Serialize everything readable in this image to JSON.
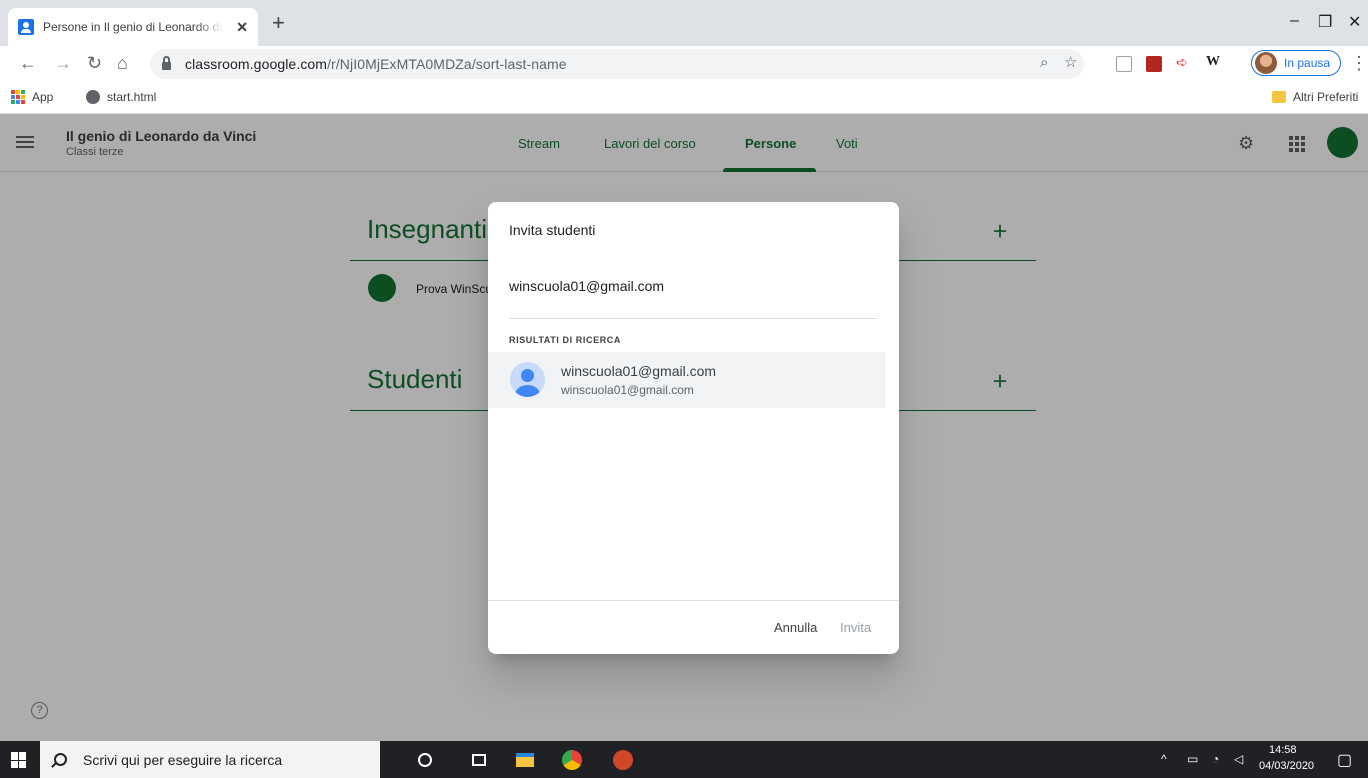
{
  "browser": {
    "tab_title": "Persone in Il genio di Leonardo da Vinci",
    "tab_close": "✕",
    "new_tab": "+",
    "url_host": "classroom.google.com",
    "url_path": "/r/NjI0MjExMTA0MDZa/sort-last-name",
    "profile_label": "In pausa",
    "bookmarks": [
      {
        "label": "App"
      },
      {
        "label": "start.html"
      }
    ],
    "other_bookmarks": "Altri Preferiti"
  },
  "app": {
    "course_title": "Il genio di Leonardo da Vinci",
    "course_subtitle": "Classi terze",
    "tabs": [
      {
        "label": "Stream"
      },
      {
        "label": "Lavori del corso"
      },
      {
        "label": "Persone"
      },
      {
        "label": "Voti"
      }
    ],
    "sections": {
      "teachers_title": "Insegnanti",
      "teacher_name": "Prova WinScuola",
      "students_title": "Studenti"
    }
  },
  "dialog": {
    "title": "Invita studenti",
    "input_value": "winscuola01@gmail.com",
    "results_label": "RISULTATI DI RICERCA",
    "result": {
      "name": "winscuola01@gmail.com",
      "email": "winscuola01@gmail.com"
    },
    "cancel_label": "Annulla",
    "invite_label": "Invita"
  },
  "taskbar": {
    "search_placeholder": "Scrivi qui per eseguire la ricerca",
    "time": "14:58",
    "date": "04/03/2020"
  },
  "colors": {
    "accent": "#137333",
    "scrim": "rgba(0,0,0,0.32)",
    "taskbar": "#202124"
  }
}
